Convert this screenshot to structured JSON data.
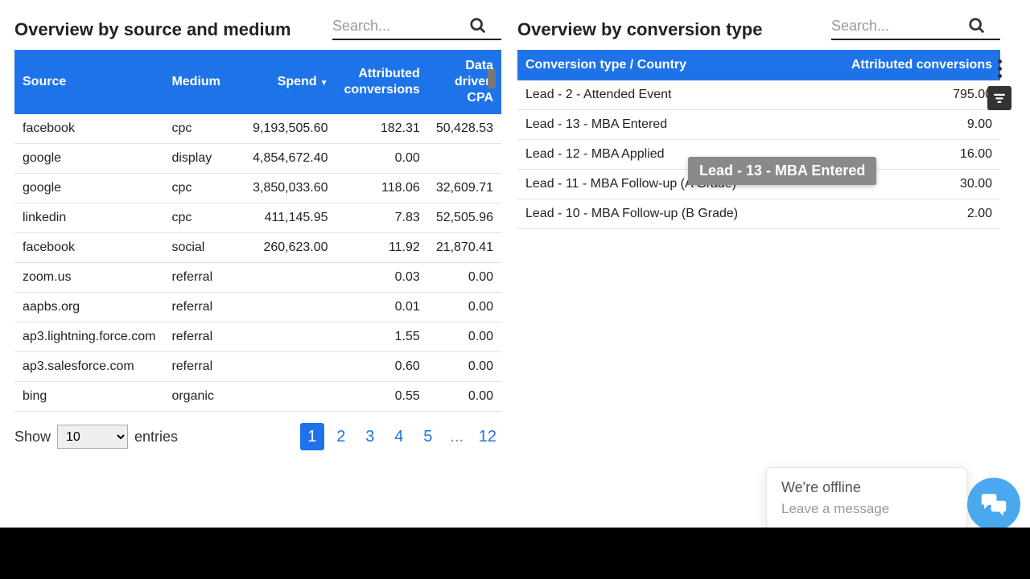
{
  "left": {
    "title": "Overview by source and medium",
    "search_placeholder": "Search...",
    "columns": {
      "source": "Source",
      "medium": "Medium",
      "spend": "Spend",
      "attr1": "Attributed",
      "attr2": "conversions",
      "cpa1": "Data",
      "cpa2": "driven",
      "cpa3": "CPA"
    },
    "rows": [
      {
        "source": "facebook",
        "medium": "cpc",
        "spend": "9,193,505.60",
        "conv": "182.31",
        "cpa": "50,428.53"
      },
      {
        "source": "google",
        "medium": "display",
        "spend": "4,854,672.40",
        "conv": "0.00",
        "cpa": ""
      },
      {
        "source": "google",
        "medium": "cpc",
        "spend": "3,850,033.60",
        "conv": "118.06",
        "cpa": "32,609.71"
      },
      {
        "source": "linkedin",
        "medium": "cpc",
        "spend": "411,145.95",
        "conv": "7.83",
        "cpa": "52,505.96"
      },
      {
        "source": "facebook",
        "medium": "social",
        "spend": "260,623.00",
        "conv": "11.92",
        "cpa": "21,870.41"
      },
      {
        "source": "zoom.us",
        "medium": "referral",
        "spend": "",
        "conv": "0.03",
        "cpa": "0.00"
      },
      {
        "source": "aapbs.org",
        "medium": "referral",
        "spend": "",
        "conv": "0.01",
        "cpa": "0.00"
      },
      {
        "source": "ap3.lightning.force.com",
        "medium": "referral",
        "spend": "",
        "conv": "1.55",
        "cpa": "0.00"
      },
      {
        "source": "ap3.salesforce.com",
        "medium": "referral",
        "spend": "",
        "conv": "0.60",
        "cpa": "0.00"
      },
      {
        "source": "bing",
        "medium": "organic",
        "spend": "",
        "conv": "0.55",
        "cpa": "0.00"
      }
    ],
    "show_label_pre": "Show",
    "show_label_post": "entries",
    "show_value": "10",
    "pages": [
      "1",
      "2",
      "3",
      "4",
      "5",
      "...",
      "12"
    ],
    "active_page": "1"
  },
  "right": {
    "title": "Overview by conversion type",
    "search_placeholder": "Search...",
    "columns": {
      "name": "Conversion type / Country",
      "value": "Attributed conversions"
    },
    "rows": [
      {
        "name": "Lead - 2 - Attended Event",
        "value": "795.00"
      },
      {
        "name": "Lead - 13 - MBA Entered",
        "value": "9.00"
      },
      {
        "name": "Lead - 12 - MBA Applied",
        "value": "16.00"
      },
      {
        "name": "Lead - 11 - MBA Follow-up (A Grade)",
        "value": "30.00"
      },
      {
        "name": "Lead - 10 - MBA Follow-up (B Grade)",
        "value": "2.00"
      }
    ]
  },
  "tooltip_text": "Lead - 13 - MBA Entered",
  "chat": {
    "line1": "We're offline",
    "line2": "Leave a message"
  }
}
